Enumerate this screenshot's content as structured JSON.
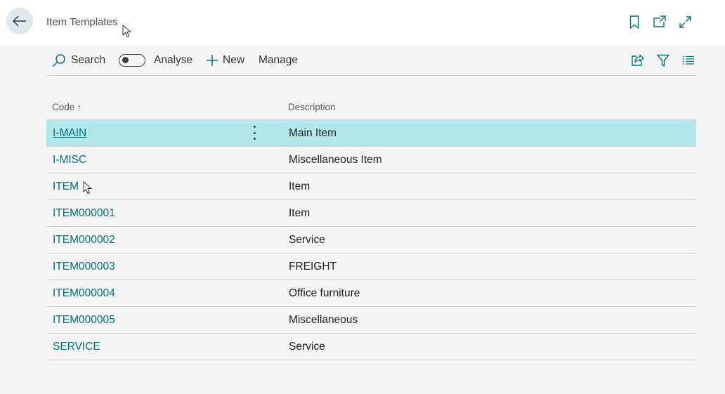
{
  "header": {
    "title": "Item Templates",
    "icons": [
      "back-arrow-icon",
      "bookmark-icon",
      "open-new-window-icon",
      "expand-icon"
    ]
  },
  "actions": {
    "search_label": "Search",
    "analyse_label": "Analyse",
    "new_label": "New",
    "manage_label": "Manage",
    "right_icons": [
      "share-icon",
      "filter-icon",
      "list-view-icon"
    ]
  },
  "table": {
    "columns": {
      "code": "Code",
      "description": "Description"
    },
    "sort_indicator": "↑",
    "rows": [
      {
        "code": "I-MAIN",
        "description": "Main Item"
      },
      {
        "code": "I-MISC",
        "description": "Miscellaneous Item"
      },
      {
        "code": "ITEM",
        "description": "Item"
      },
      {
        "code": "ITEM000001",
        "description": "Item"
      },
      {
        "code": "ITEM000002",
        "description": "Service"
      },
      {
        "code": "ITEM000003",
        "description": "FREIGHT"
      },
      {
        "code": "ITEM000004",
        "description": "Office furniture"
      },
      {
        "code": "ITEM000005",
        "description": "Miscellaneous"
      },
      {
        "code": "SERVICE",
        "description": "Service"
      }
    ]
  },
  "colors": {
    "accent": "#00707a",
    "selected_row": "#b2e7eb",
    "background": "#f4f4f4"
  }
}
